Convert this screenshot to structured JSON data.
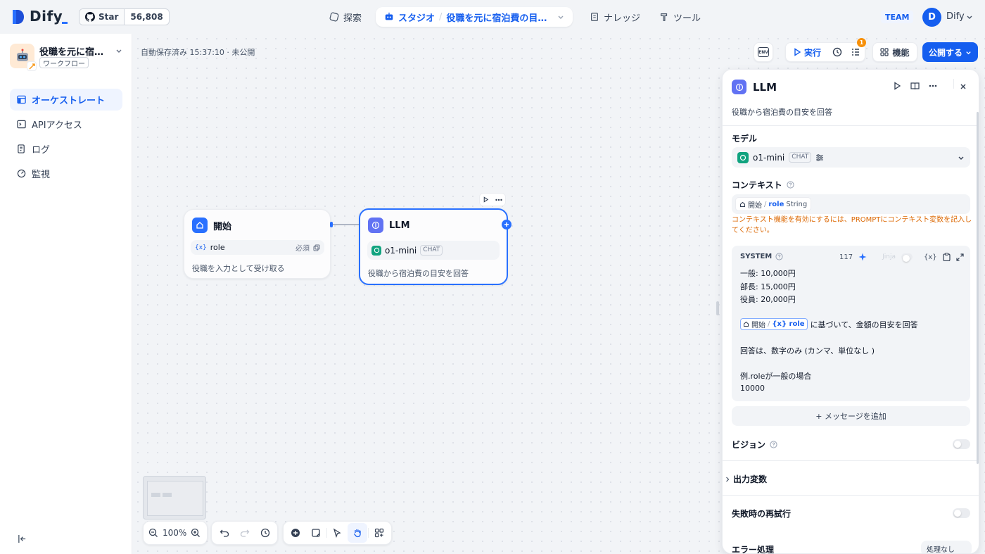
{
  "header": {
    "logo_text": "Dify",
    "github": {
      "star_label": "Star",
      "star_count": "56,808"
    },
    "nav": {
      "explore": "探索",
      "studio": "スタジオ",
      "current_app": "役職を元に宿泊費の目安...",
      "knowledge": "ナレッジ",
      "tools": "ツール"
    },
    "team_badge": "TEAM",
    "user": {
      "initial": "D",
      "name": "Dify"
    }
  },
  "sidebar": {
    "app_name": "役職を元に宿泊...",
    "app_type": "ワークフロー",
    "items": [
      {
        "label": "オーケストレート",
        "icon": "layout-icon",
        "active": true
      },
      {
        "label": "APIアクセス",
        "icon": "terminal-icon",
        "active": false
      },
      {
        "label": "ログ",
        "icon": "log-icon",
        "active": false
      },
      {
        "label": "監視",
        "icon": "monitor-icon",
        "active": false
      }
    ]
  },
  "canvas": {
    "autosave": "自動保存済み 15:37:10 · 未公開",
    "toolbar": {
      "env": "ENV",
      "run": "実行",
      "badge": "1",
      "features": "機能",
      "publish": "公開する"
    },
    "start_node": {
      "title": "開始",
      "var_symbol": "{x}",
      "var_name": "role",
      "required": "必須",
      "desc": "役職を入力として受け取る"
    },
    "llm_node": {
      "title": "LLM",
      "model": "o1-mini",
      "model_tag": "CHAT",
      "desc": "役職から宿泊費の目安を回答"
    },
    "zoom": "100%"
  },
  "panel": {
    "title": "LLM",
    "description": "役職から宿泊費の目安を回答",
    "model_label": "モデル",
    "model_name": "o1-mini",
    "model_tag": "CHAT",
    "context_label": "コンテキスト",
    "context_var": {
      "node": "開始",
      "sep": "/",
      "name": "role",
      "type": "String"
    },
    "context_warning": "コンテキスト機能を有効にするには、PROMPTにコンテキスト変数を記入してください。",
    "system": {
      "label": "SYSTEM",
      "count": "117",
      "jinja": "Jinja",
      "var_symbol": "{x}",
      "lines": [
        "一般: 10,000円",
        "部長: 15,000円",
        "役員: 20,000円"
      ],
      "ref_node": "開始",
      "ref_var": "{x} role",
      "ref_suffix": "に基づいて、金額の目安を回答",
      "line_answer": "回答は、数字のみ (カンマ、単位なし )",
      "line_example": "例.roleが一般の場合",
      "line_value": "10000"
    },
    "add_message": "+ メッセージを追加",
    "vision_label": "ビジョン",
    "output_label": "出力変数",
    "retry_label": "失敗時の再試行",
    "error_label": "エラー処理",
    "error_value": "処理なし"
  },
  "colors": {
    "accent": "#155eef",
    "warning": "#dc6803",
    "llm_icon": "#6172f3",
    "openai_green": "#10a37f"
  }
}
